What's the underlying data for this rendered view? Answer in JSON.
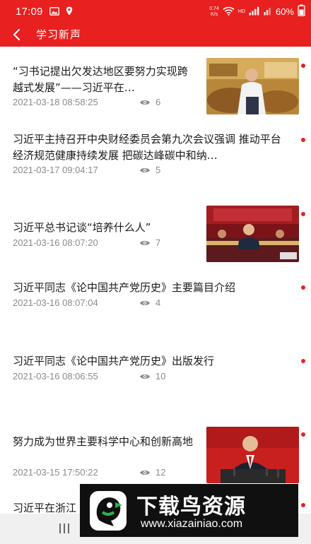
{
  "status_bar": {
    "time": "17:09",
    "speed_value": "0.74",
    "speed_unit": "K/s",
    "network_label": "HD",
    "battery": "60%"
  },
  "header": {
    "title": "学习新声"
  },
  "news": [
    {
      "title": "“习书记提出欠发达地区要努力实现跨越式发展”——习近平在…",
      "date": "2021-03-18 08:58:25",
      "views": "6",
      "has_thumb": true
    },
    {
      "title": "习近平主持召开中央财经委员会第九次会议强调 推动平台经济规范健康持续发展 把碳达峰碳中和纳…",
      "date": "2021-03-17 09:04:17",
      "views": "5",
      "has_thumb": false
    },
    {
      "title": "习近平总书记谈“培养什么人”",
      "date": "2021-03-16 08:07:20",
      "views": "7",
      "has_thumb": true
    },
    {
      "title": "习近平同志《论中国共产党历史》主要篇目介绍",
      "date": "2021-03-16 08:07:04",
      "views": "4",
      "has_thumb": false
    },
    {
      "title": "习近平同志《论中国共产党历史》出版发行",
      "date": "2021-03-16 08:06:55",
      "views": "10",
      "has_thumb": false
    },
    {
      "title": "努力成为世界主要科学中心和创新高地",
      "date": "2021-03-15 17:50:22",
      "views": "12",
      "has_thumb": true
    },
    {
      "title": "习近平在浙江",
      "date": "",
      "views": "",
      "has_thumb": false
    }
  ],
  "watermark": {
    "title": "下载鸟资源",
    "url": "www.xiazainiao.com"
  },
  "colors": {
    "brand_red": "#e8201f",
    "meta_gray": "#8a8a8a"
  },
  "icons": [
    "gallery-icon",
    "location-icon",
    "wifi-icon",
    "signal-icon",
    "battery-icon",
    "back-arrow-icon",
    "eye-icon",
    "recent-apps-icon"
  ]
}
